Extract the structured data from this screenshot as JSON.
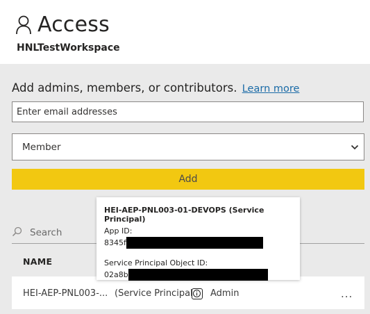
{
  "header": {
    "title": "Access",
    "subtitle": "HNLTestWorkspace",
    "icon": "person-icon"
  },
  "add_section": {
    "prompt": "Add admins, members, or contributors.",
    "learn_more": "Learn more",
    "email_placeholder": "Enter email addresses",
    "role_selected": "Member",
    "add_button": "Add"
  },
  "search": {
    "label": "Search",
    "icon": "search-icon"
  },
  "table": {
    "column_name": "NAME",
    "rows": [
      {
        "name": "HEI-AEP-PNL003-...",
        "type": "(Service Principal)",
        "role": "Admin",
        "more": "..."
      }
    ]
  },
  "tooltip": {
    "title": "HEI-AEP-PNL003-01-DEVOPS (Service Principal)",
    "app_id_label": "App ID:",
    "app_id_value": "8345f",
    "object_id_label": "Service Principal Object ID:",
    "object_id_value": "02a8b"
  },
  "colors": {
    "accent_button": "#f2c811",
    "panel_bg": "#eaeaea",
    "link": "#1a6ba7"
  }
}
